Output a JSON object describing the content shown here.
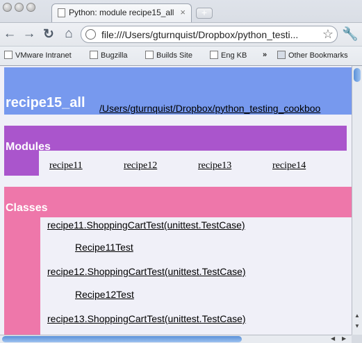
{
  "window": {
    "tab_title": "Python: module recipe15_all",
    "tab_close": "×",
    "new_tab": "+"
  },
  "toolbar": {
    "back_icon": "arrow-left-icon",
    "forward_icon": "arrow-right-icon",
    "reload_icon": "reload-icon",
    "home_icon": "home-icon",
    "url": "file:///Users/gturnquist/Dropbox/python_testi...",
    "star_icon": "star-icon",
    "wrench_icon": "wrench-icon"
  },
  "bookmarks": {
    "items": [
      "VMware Intranet",
      "Bugzilla",
      "Builds Site",
      "Eng KB"
    ],
    "overflow": "»",
    "other": "Other Bookmarks"
  },
  "page": {
    "title": "recipe15_all",
    "path_link": "/Users/gturnquist/Dropbox/python_testing_cookboo",
    "modules_heading": "Modules",
    "modules": [
      "recipe11",
      "recipe12",
      "recipe13",
      "recipe14"
    ],
    "classes_heading": "Classes",
    "classes": [
      "recipe11.ShoppingCartTest(unittest.TestCase)",
      "Recipe11Test",
      "recipe12.ShoppingCartTest(unittest.TestCase)",
      "Recipe12Test",
      "recipe13.ShoppingCartTest(unittest.TestCase)"
    ]
  },
  "colors": {
    "heading": "#7799ee",
    "modules": "#aa55cc",
    "classes": "#ee77aa",
    "background": "#f0f0f8"
  }
}
